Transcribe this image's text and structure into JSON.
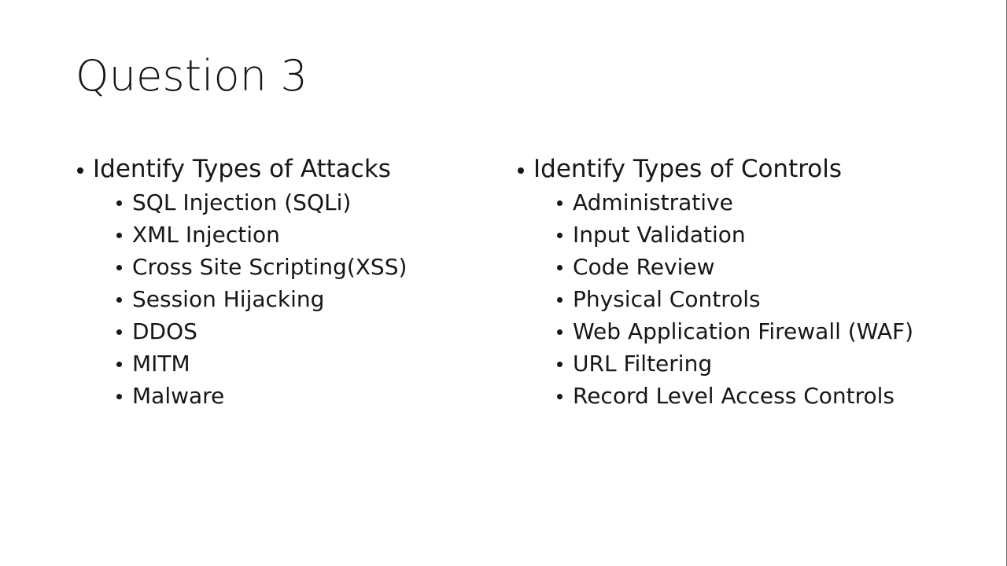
{
  "slide": {
    "title": "Question 3",
    "background_color": "#ffffff",
    "text_color": "#171717",
    "edge_rule_color": "#6b6b70",
    "bullet_glyph": "bullet-dot"
  },
  "columns": [
    {
      "id": "attacks",
      "heading": "Identify Types of Attacks",
      "items": [
        "SQL Injection (SQLi)",
        "XML Injection",
        "Cross Site Scripting(XSS)",
        "Session Hijacking",
        "DDOS",
        "MITM",
        "Malware"
      ]
    },
    {
      "id": "controls",
      "heading": "Identify Types of Controls",
      "items": [
        "Administrative",
        "Input Validation",
        "Code Review",
        "Physical Controls",
        "Web Application Firewall (WAF)",
        "URL Filtering",
        "Record Level Access Controls"
      ]
    }
  ]
}
